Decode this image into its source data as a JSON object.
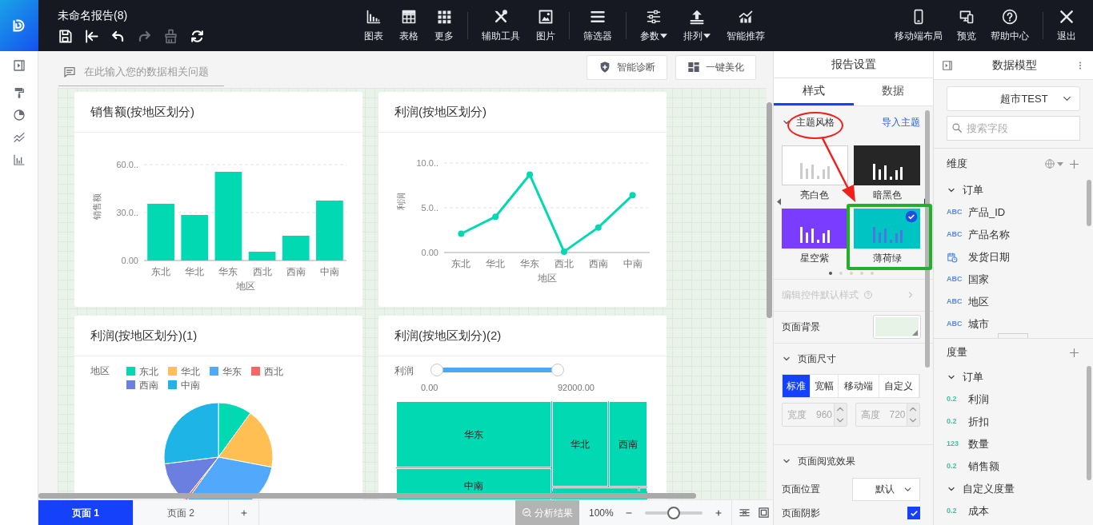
{
  "app": {
    "title": "未命名报告(8)"
  },
  "quick_actions": [
    {
      "kind": "save",
      "disabled": false
    },
    {
      "kind": "back",
      "disabled": false
    },
    {
      "kind": "undo",
      "disabled": false
    },
    {
      "kind": "redo",
      "disabled": true
    },
    {
      "kind": "brush",
      "disabled": true
    },
    {
      "kind": "refresh",
      "disabled": false
    }
  ],
  "toolbar_groups": [
    [
      {
        "kind": "chart",
        "label": "图表",
        "dropdown": false
      },
      {
        "kind": "table",
        "label": "表格",
        "dropdown": false
      },
      {
        "kind": "more",
        "label": "更多",
        "dropdown": false
      }
    ],
    [
      {
        "kind": "tools",
        "label": "辅助工具",
        "dropdown": false
      },
      {
        "kind": "image",
        "label": "图片",
        "dropdown": false
      }
    ],
    [
      {
        "kind": "filter",
        "label": "筛选器",
        "dropdown": false
      }
    ],
    [
      {
        "kind": "params",
        "label": "参数",
        "dropdown": true
      },
      {
        "kind": "sort",
        "label": "排列",
        "dropdown": true
      },
      {
        "kind": "recommend",
        "label": "智能推荐",
        "dropdown": false
      }
    ]
  ],
  "right_groups": [
    [
      {
        "kind": "mobile",
        "label": "移动端布局"
      },
      {
        "kind": "preview",
        "label": "预览"
      },
      {
        "kind": "help",
        "label": "帮助中心"
      }
    ],
    [
      {
        "kind": "exit",
        "label": "退出"
      }
    ]
  ],
  "canvas": {
    "question": {
      "placeholder": "在此输入您的数据相关问题"
    },
    "buttons": [
      {
        "kind": "diagnose",
        "label": "智能诊断"
      },
      {
        "kind": "beautify",
        "label": "一键美化"
      }
    ],
    "cards": [
      {
        "kind": "bar",
        "title": "销售额(按地区划分)",
        "chart_data": {
          "type": "bar",
          "xlabel": "地区",
          "ylabel": "销售额",
          "categories": [
            "东北",
            "华北",
            "华东",
            "西北",
            "西南",
            "中南"
          ],
          "series": [
            {
              "color": "#00d9b2",
              "values": [
                35.5,
                28.5,
                55.5,
                5.5,
                15.5,
                37.5
              ]
            }
          ],
          "ylim": [
            0,
            60
          ],
          "yticks": [
            {
              "value": 0,
              "label": "0.00"
            },
            {
              "value": 30,
              "label": "30.0.."
            },
            {
              "value": 60,
              "label": "60.0.."
            }
          ]
        }
      },
      {
        "kind": "line",
        "title": "利润(按地区划分)",
        "chart_data": {
          "type": "line",
          "xlabel": "地区",
          "ylabel": "利润",
          "categories": [
            "东北",
            "华北",
            "华东",
            "西北",
            "西南",
            "中南"
          ],
          "series": [
            {
              "color": "#00d9b2",
              "marker": true,
              "values": [
                2.1,
                4.0,
                8.7,
                0.1,
                2.8,
                6.4
              ]
            }
          ],
          "ylim": [
            0,
            10
          ],
          "yticks": [
            {
              "value": 0,
              "label": "0.00"
            },
            {
              "value": 5,
              "label": "5.0.."
            },
            {
              "value": 10,
              "label": "10.0.."
            }
          ]
        }
      },
      {
        "kind": "pie",
        "title": "利润(按地区划分)(1)",
        "legend": {
          "title": "地区",
          "items": [
            {
              "label": "东北",
              "color": "#00d9b2"
            },
            {
              "label": "华北",
              "color": "#ffbf52"
            },
            {
              "label": "华东",
              "color": "#52a8fa"
            },
            {
              "label": "西北",
              "color": "#f76767"
            },
            {
              "label": "西南",
              "color": "#6a7fe0"
            },
            {
              "label": "中南",
              "color": "#1eb4e6"
            }
          ]
        }
      },
      {
        "kind": "treemap",
        "title": "利润(按地区划分)(2)",
        "filter": {
          "label": "利润",
          "min": "0.00",
          "max": "92000.00",
          "level": 1
        },
        "tiles": [
          "华东",
          "华北",
          "西南",
          "中南"
        ]
      }
    ]
  },
  "pages": [
    {
      "label": "页面 1",
      "selected": true
    },
    {
      "label": "页面 2",
      "selected": false
    }
  ],
  "status": {
    "analysis": {
      "label": "分析结果",
      "disabled": true
    },
    "zoom": {
      "reading": "100%",
      "level": 0.5
    }
  },
  "report_settings": {
    "title": "报告设置",
    "tabs": [
      {
        "label": "样式",
        "selected": true
      },
      {
        "label": "数据",
        "selected": false
      }
    ],
    "theme": {
      "label": "主题风格",
      "expanded": true,
      "import_link": "导入主题",
      "themes": [
        {
          "kind": "light",
          "label": "亮白色",
          "selected": false
        },
        {
          "kind": "dark",
          "label": "暗黑色",
          "selected": false
        },
        {
          "kind": "purple",
          "label": "星空紫",
          "selected": false
        },
        {
          "kind": "mint",
          "label": "薄荷绿",
          "selected": true
        }
      ],
      "carousel": [
        {
          "selected": true
        },
        {
          "selected": false
        },
        {
          "selected": false
        },
        {
          "selected": false
        },
        {
          "selected": false
        }
      ]
    },
    "edit_defaults": {
      "label": "编辑控件默认样式",
      "disabled": true
    },
    "background": {
      "label": "页面背景"
    },
    "size": {
      "label": "页面尺寸",
      "expanded": true,
      "options": [
        {
          "label": "标准",
          "selected": true
        },
        {
          "label": "宽幅",
          "selected": false
        },
        {
          "label": "移动端",
          "selected": false
        },
        {
          "label": "自定义",
          "selected": false
        }
      ],
      "width": {
        "label": "宽度",
        "value": "960",
        "disabled": true
      },
      "height": {
        "label": "高度",
        "value": "720",
        "disabled": true
      }
    },
    "view": {
      "label": "页面阅览效果",
      "expanded": true,
      "position": {
        "label": "页面位置",
        "value": "默认"
      },
      "shadow": {
        "label": "页面阴影",
        "checked": true
      }
    }
  },
  "data_model": {
    "title": "数据模型",
    "source": "超市TEST",
    "search": {
      "placeholder": "搜索字段"
    },
    "sections": [
      {
        "kind": "dimension",
        "label": "维度",
        "groups": [
          {
            "label": "订单",
            "expanded": true,
            "children": [
              {
                "kind": "text",
                "badge": "ABC",
                "name": "产品_ID"
              },
              {
                "kind": "text",
                "badge": "ABC",
                "name": "产品名称"
              },
              {
                "kind": "date",
                "name": "发货日期"
              },
              {
                "kind": "text",
                "badge": "ABC",
                "name": "国家"
              },
              {
                "kind": "text",
                "badge": "ABC",
                "name": "地区"
              },
              {
                "kind": "text",
                "badge": "ABC",
                "name": "城市"
              }
            ]
          }
        ]
      },
      {
        "kind": "measure",
        "label": "度量",
        "groups": [
          {
            "label": "订单",
            "expanded": true,
            "children": [
              {
                "kind": "number",
                "badge": "0.2",
                "name": "利润"
              },
              {
                "kind": "number",
                "badge": "0.2",
                "name": "折扣"
              },
              {
                "kind": "number",
                "badge": "123",
                "name": "数量"
              },
              {
                "kind": "number",
                "badge": "0.2",
                "name": "销售额"
              }
            ]
          },
          {
            "label": "自定义度量",
            "expanded": true,
            "children": [
              {
                "kind": "number",
                "badge": "0.2",
                "name": "成本"
              }
            ]
          }
        ]
      }
    ]
  }
}
